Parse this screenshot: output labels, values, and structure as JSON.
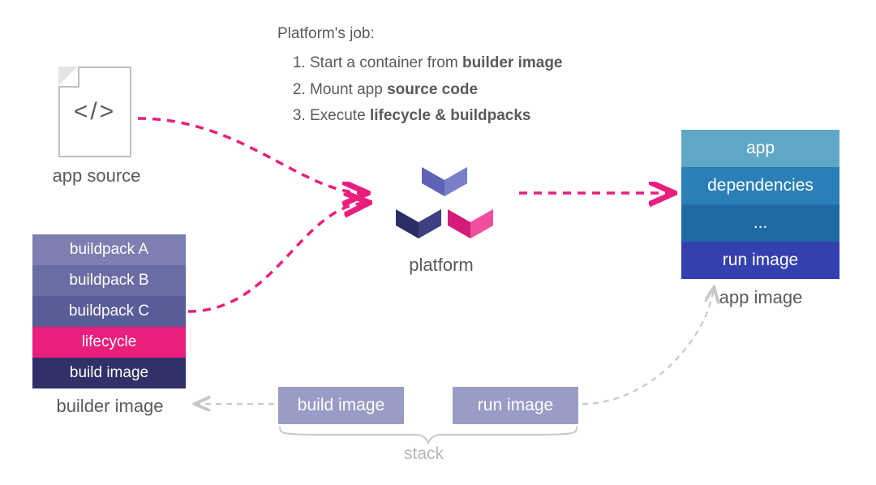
{
  "jobs": {
    "title": "Platform's job:",
    "items": [
      {
        "prefix": "Start a container from ",
        "bold": "builder image"
      },
      {
        "prefix": "Mount app ",
        "bold": "source code"
      },
      {
        "prefix": "Execute ",
        "bold": "lifecycle & buildpacks"
      }
    ]
  },
  "app_source": {
    "code_glyph": "</>",
    "label": "app source"
  },
  "builder_image": {
    "rows": [
      "buildpack A",
      "buildpack B",
      "buildpack C",
      "lifecycle",
      "build image"
    ],
    "label": "builder image"
  },
  "platform": {
    "label": "platform"
  },
  "app_image": {
    "rows": [
      "app",
      "dependencies",
      "...",
      "run image"
    ],
    "label": "app image"
  },
  "stack": {
    "build": "build image",
    "run": "run image",
    "label": "stack"
  },
  "colors": {
    "pink": "#e91e7d",
    "grey": "#b5b5b5"
  }
}
